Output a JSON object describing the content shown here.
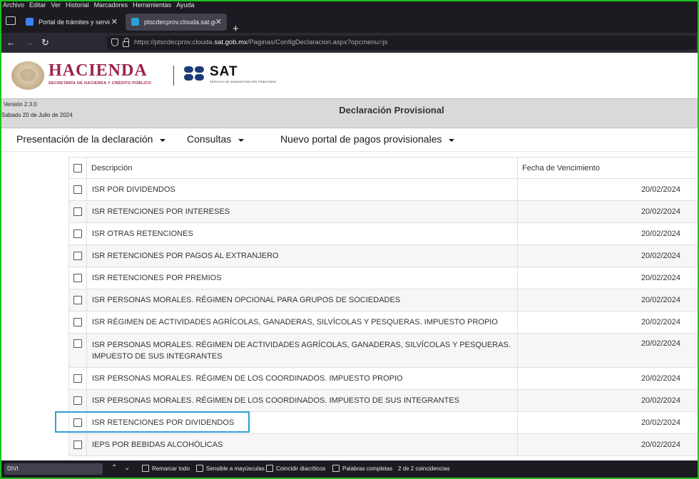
{
  "browser": {
    "menu": [
      "Archivo",
      "Editar",
      "Ver",
      "Historial",
      "Marcadores",
      "Herramientas",
      "Ayuda"
    ],
    "tabs": [
      {
        "title": "Portal de trámites y servicios - S",
        "active": false
      },
      {
        "title": "ptscdecprov.clouda.sat.gob.mx",
        "active": true
      }
    ],
    "url_prefix": "https://ptscdecprov.clouda.",
    "url_domain": "sat.gob.mx",
    "url_suffix": "/Paginas/ConfigDeclaracion.aspx?opcmenu=js",
    "colors": {
      "tab_fav_1": "#3b82f6",
      "tab_fav_2": "#2d9fd8",
      "frame": "#1fc41f"
    }
  },
  "header": {
    "hacienda": "HACIENDA",
    "hacienda_sub": "SECRETARÍA DE HACIENDA Y CRÉDITO PÚBLICO",
    "sat": "SAT",
    "sat_sub": "SERVICIO DE ADMINISTRACIÓN TRIBUTARIA",
    "brand_color": "#9b2247"
  },
  "status": {
    "version": "Versión 2.3.0",
    "date": "Sabado 20 de Julio de 2024",
    "title": "Declaración Provisional"
  },
  "nav": {
    "items": [
      "Presentación de la declaración",
      "Consultas",
      "Nuevo portal de pagos provisionales"
    ]
  },
  "table": {
    "headers": [
      "Descripción",
      "Fecha de Vencimiento"
    ],
    "rows": [
      {
        "desc": "ISR POR DIVIDENDOS",
        "date": "20/02/2024"
      },
      {
        "desc": "ISR RETENCIONES POR INTERESES",
        "date": "20/02/2024"
      },
      {
        "desc": "ISR OTRAS RETENCIONES",
        "date": "20/02/2024"
      },
      {
        "desc": "ISR RETENCIONES POR PAGOS AL EXTRANJERO",
        "date": "20/02/2024"
      },
      {
        "desc": "ISR RETENCIONES POR PREMIOS",
        "date": "20/02/2024"
      },
      {
        "desc": "ISR PERSONAS MORALES. RÉGIMEN OPCIONAL PARA GRUPOS DE SOCIEDADES",
        "date": "20/02/2024"
      },
      {
        "desc": "ISR RÉGIMEN DE ACTIVIDADES AGRÍCOLAS, GANADERAS, SILVÍCOLAS Y PESQUERAS. IMPUESTO PROPIO",
        "date": "20/02/2024"
      },
      {
        "desc": "ISR PERSONAS MORALES. RÉGIMEN DE ACTIVIDADES AGRÍCOLAS, GANADERAS, SILVÍCOLAS Y PESQUERAS. IMPUESTO DE SUS INTEGRANTES",
        "date": "20/02/2024"
      },
      {
        "desc": "ISR PERSONAS MORALES. RÉGIMEN DE LOS COORDINADOS. IMPUESTO PROPIO",
        "date": "20/02/2024"
      },
      {
        "desc": "ISR PERSONAS MORALES. RÉGIMEN DE LOS COORDINADOS. IMPUESTO DE SUS INTEGRANTES",
        "date": "20/02/2024"
      },
      {
        "desc": "ISR RETENCIONES POR DIVIDENDOS",
        "date": "20/02/2024"
      },
      {
        "desc": "IEPS POR BEBIDAS ALCOHÓLICAS",
        "date": "20/02/2024"
      }
    ]
  },
  "findbar": {
    "query": "DIVI",
    "options": [
      "Remarcar todo",
      "Sensible a mayúsculas",
      "Coincidir diacríticos",
      "Palabras completas"
    ],
    "result": "2 de 2 coincidencias"
  }
}
